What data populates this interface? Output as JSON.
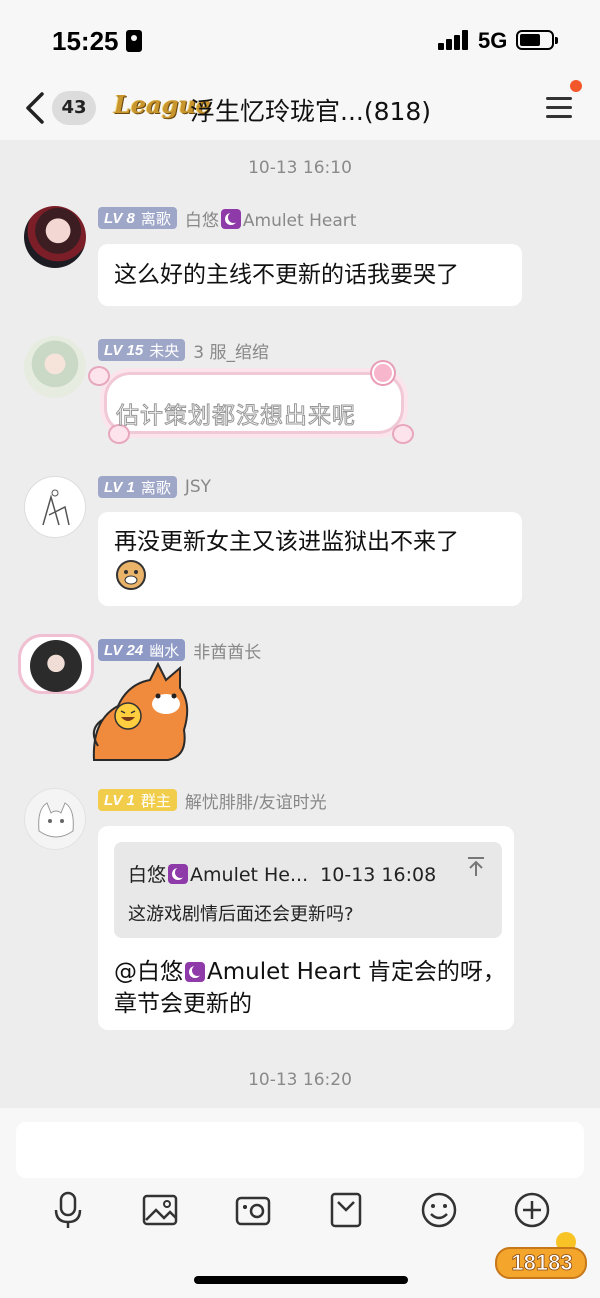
{
  "status_bar": {
    "time": "15:25",
    "network": "5G"
  },
  "header": {
    "unread_count": "43",
    "logo_text": "League",
    "title": "浮生忆玲珑官...(818)"
  },
  "timestamps": [
    "10-13 16:10",
    "10-13 16:20"
  ],
  "messages": [
    {
      "level": "LV 8",
      "rank": "离歌",
      "sender_prefix": "白悠",
      "sender_suffix": "Amulet Heart",
      "text": "这么好的主线不更新的话我要哭了",
      "badge_color": "#9fa7c8"
    },
    {
      "level": "LV 15",
      "rank": "未央",
      "sender": "3 服_绾绾",
      "text": "估计策划都没想出来呢",
      "badge_color": "#9fa7c8"
    },
    {
      "level": "LV 1",
      "rank": "离歌",
      "sender": "JSY",
      "text": "再没更新女主又该进监狱出不来了",
      "badge_color": "#9fa7c8"
    },
    {
      "level": "LV 24",
      "rank": "幽水",
      "sender": "非酋酋长",
      "badge_color": "#8e99c6"
    },
    {
      "level": "LV 1",
      "rank": "群主",
      "sender": "解忧腓腓/友谊时光",
      "badge_color": "#f2cd4b",
      "quote": {
        "author_prefix": "白悠",
        "author_suffix": "Amulet He...",
        "time": "10-13 16:08",
        "text": "这游戏剧情后面还会更新吗?"
      },
      "reply_prefix": "@白悠",
      "reply_suffix": "Amulet Heart 肯定会的呀，章节会更新的"
    }
  ],
  "toolbar": [
    "microphone-icon",
    "image-icon",
    "video-icon",
    "sticker-box-icon",
    "emoji-icon",
    "plus-icon"
  ],
  "watermark": "18183"
}
